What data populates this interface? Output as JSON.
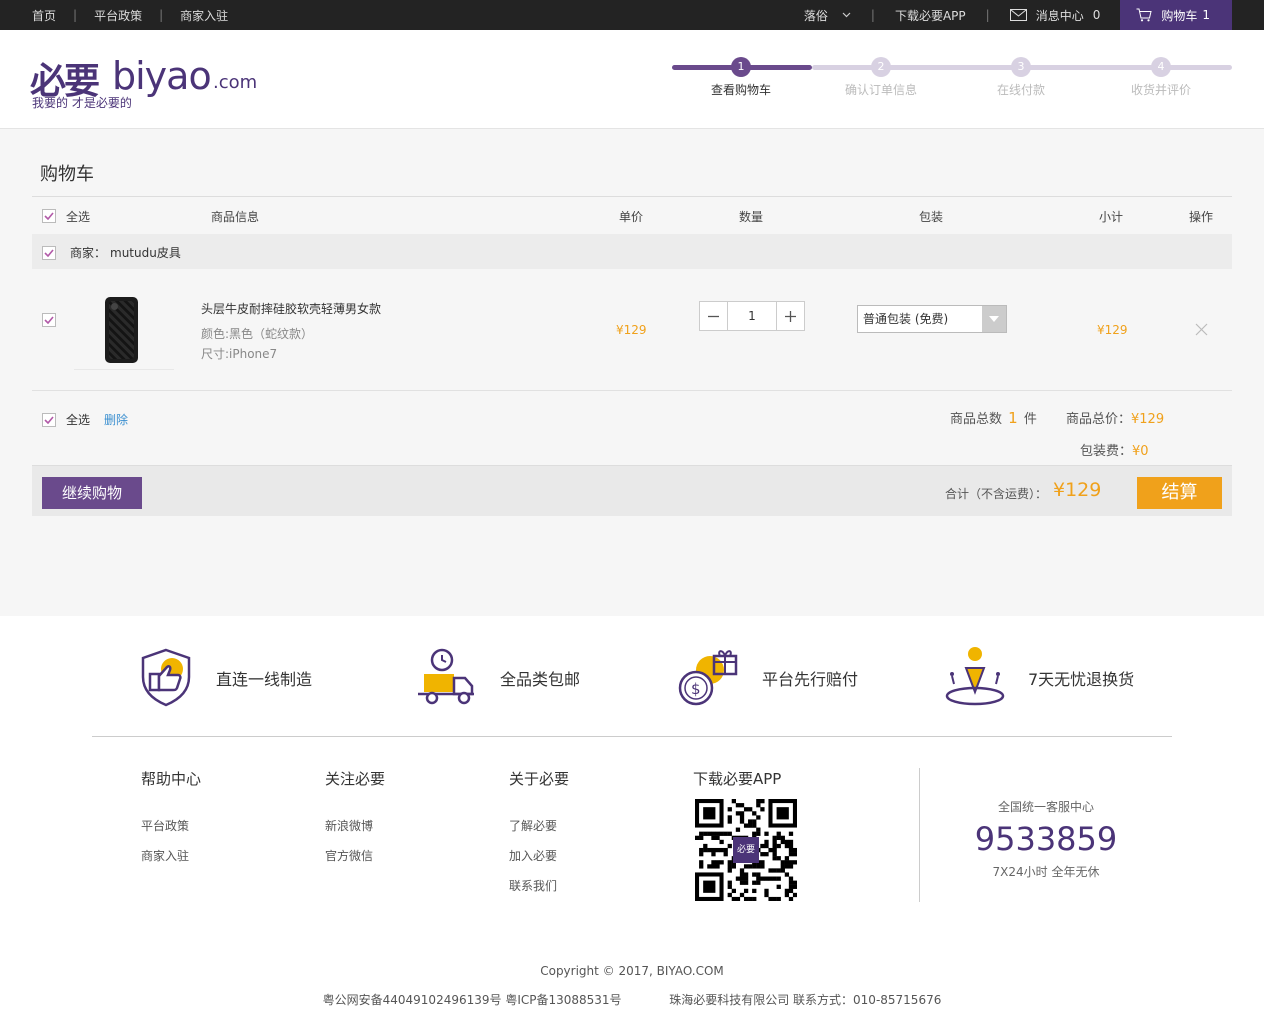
{
  "topbar": {
    "left_links": [
      "首页",
      "平台政策",
      "商家入驻"
    ],
    "city": "落俗",
    "download": "下载必要APP",
    "messages_label": "消息中心",
    "messages_count": "0",
    "cart_label": "购物车",
    "cart_count": "1"
  },
  "logo": {
    "cn": "必要",
    "en": "biyao",
    "com": ".com",
    "slogan": "我要的 才是必要的"
  },
  "steps": [
    {
      "num": "1",
      "label": "查看购物车",
      "active": true
    },
    {
      "num": "2",
      "label": "确认订单信息",
      "active": false
    },
    {
      "num": "3",
      "label": "在线付款",
      "active": false
    },
    {
      "num": "4",
      "label": "收货并评价",
      "active": false
    }
  ],
  "cart": {
    "title": "购物车",
    "columns": {
      "select_all": "全选",
      "info": "商品信息",
      "price": "单价",
      "qty": "数量",
      "pack": "包装",
      "subtotal": "小计",
      "ops": "操作"
    },
    "shop_label": "商家：",
    "shop_name": "mutudu皮具",
    "item": {
      "name": "头层牛皮耐摔硅胶软壳轻薄男女款",
      "color": "颜色:黑色（蛇纹款）",
      "size": "尺寸:iPhone7",
      "price": "¥129",
      "qty": "1",
      "pack": "普通包装 (免费)",
      "subtotal": "¥129"
    },
    "bottom": {
      "select_all": "全选",
      "delete": "删除",
      "count_prefix": "商品总数",
      "count": "1",
      "count_suffix": "件",
      "total_label": "商品总价：",
      "total": "¥129",
      "pack_label": "包装费：",
      "pack_fee": "¥0"
    },
    "continue_btn": "继续购物",
    "grand_label": "合计（不含运费）：",
    "grand_total": "¥129",
    "pay_btn": "结算"
  },
  "footer": {
    "promises": [
      "直连一线制造",
      "全品类包邮",
      "平台先行赔付",
      "7天无忧退换货"
    ],
    "columns": [
      {
        "title": "帮助中心",
        "links": [
          "平台政策",
          "商家入驻"
        ]
      },
      {
        "title": "关注必要",
        "links": [
          "新浪微博",
          "官方微信"
        ]
      },
      {
        "title": "关于必要",
        "links": [
          "了解必要",
          "加入必要",
          "联系我们"
        ]
      }
    ],
    "app_title": "下载必要APP",
    "qr_center": "必要",
    "service_title": "全国统一客服中心",
    "service_phone": "9533859",
    "service_hours": "7X24小时 全年无休",
    "copyright": "Copyright © 2017, BIYAO.COM",
    "icp": "粤公网安备44049102496139号 粤ICP备13088531号",
    "company": "珠海必要科技有限公司 联系方式：010-85715676"
  },
  "colors": {
    "brand": "#4b3478",
    "accent": "#f0a11b"
  }
}
